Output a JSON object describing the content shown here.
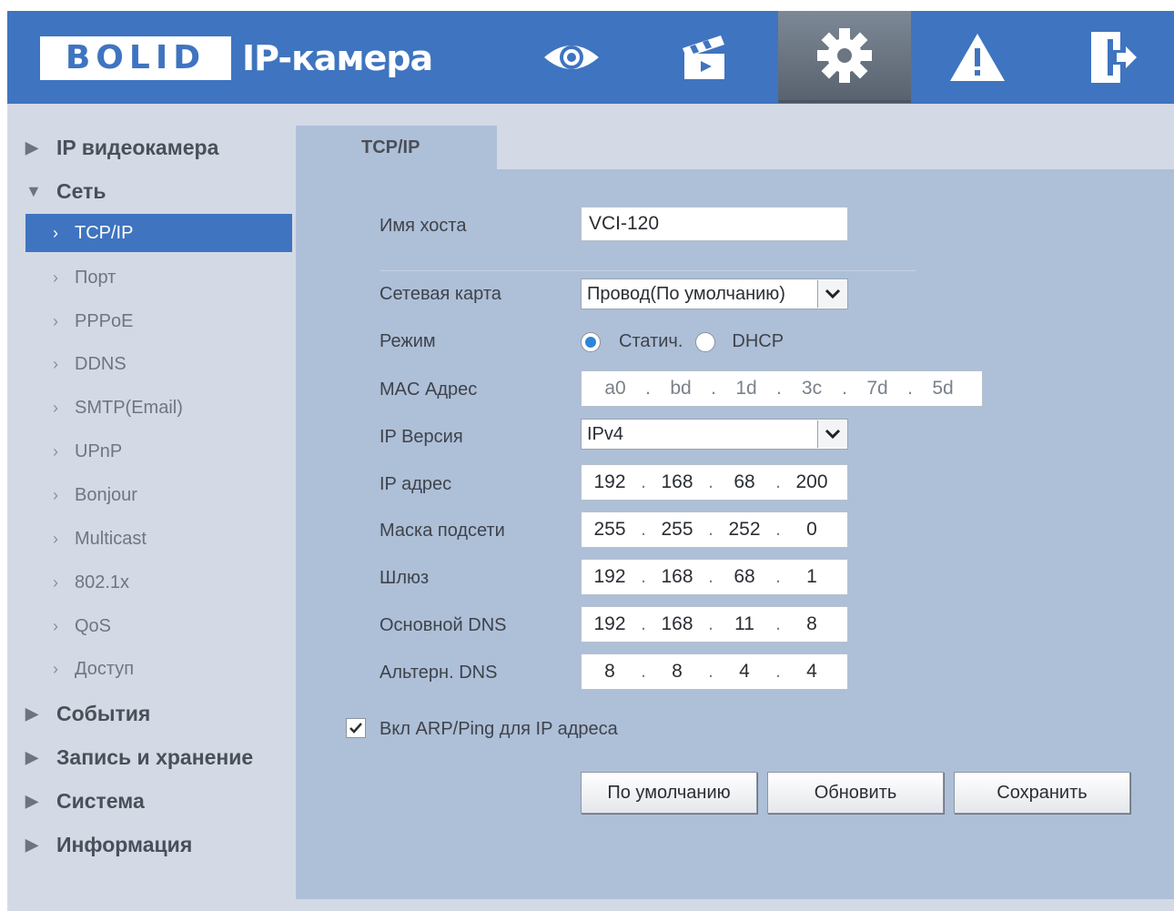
{
  "header": {
    "logo_text": "BOLID",
    "app_title": "IP-камера",
    "nav": [
      {
        "icon": "eye-icon"
      },
      {
        "icon": "clapperboard-icon"
      },
      {
        "icon": "gear-icon",
        "active": true
      },
      {
        "icon": "warning-icon"
      },
      {
        "icon": "logout-icon"
      }
    ]
  },
  "sidebar": {
    "sections": [
      {
        "label": "IP видеокамера",
        "arrow": "▶"
      },
      {
        "label": "Сеть",
        "arrow": "▼"
      },
      {
        "label": "События",
        "arrow": "▶"
      },
      {
        "label": "Запись и хранение",
        "arrow": "▶"
      },
      {
        "label": "Система",
        "arrow": "▶"
      },
      {
        "label": "Информация",
        "arrow": "▶"
      }
    ],
    "network_items": [
      {
        "label": "TCP/IP",
        "active": true
      },
      {
        "label": "Порт"
      },
      {
        "label": "PPPoE"
      },
      {
        "label": "DDNS"
      },
      {
        "label": "SMTP(Email)"
      },
      {
        "label": "UPnP"
      },
      {
        "label": "Bonjour"
      },
      {
        "label": "Multicast"
      },
      {
        "label": "802.1x"
      },
      {
        "label": "QoS"
      },
      {
        "label": "Доступ"
      }
    ]
  },
  "main": {
    "tab_label": "TCP/IP",
    "hostname": {
      "label": "Имя хоста",
      "value": "VCI-120"
    },
    "nic": {
      "label": "Сетевая карта",
      "value": "Провод(По умолчанию)"
    },
    "mode": {
      "label": "Режим",
      "option_static": "Статич.",
      "option_dhcp": "DHCP",
      "selected": "static"
    },
    "mac": {
      "label": "MAC Адрес",
      "segments": [
        "a0",
        "bd",
        "1d",
        "3c",
        "7d",
        "5d"
      ]
    },
    "ip_version": {
      "label": "IP Версия",
      "value": "IPv4"
    },
    "ip_address": {
      "label": "IP адрес",
      "octets": [
        "192",
        "168",
        "68",
        "200"
      ]
    },
    "subnet_mask": {
      "label": "Маска подсети",
      "octets": [
        "255",
        "255",
        "252",
        "0"
      ]
    },
    "gateway": {
      "label": "Шлюз",
      "octets": [
        "192",
        "168",
        "68",
        "1"
      ]
    },
    "dns_primary": {
      "label": "Основной DNS",
      "octets": [
        "192",
        "168",
        "11",
        "8"
      ]
    },
    "dns_alt": {
      "label": "Альтерн. DNS",
      "octets": [
        "8",
        "8",
        "4",
        "4"
      ]
    },
    "arp_ping": {
      "label": "Вкл ARP/Ping для IP адреса",
      "checked": true
    },
    "buttons": {
      "default": "По умолчанию",
      "refresh": "Обновить",
      "save": "Сохранить"
    }
  },
  "colors": {
    "header_bg": "#3f74c0",
    "active_item_bg": "#3f74c0",
    "panel_bg": "#aebfd8",
    "radio_accent": "#2e86d6"
  }
}
